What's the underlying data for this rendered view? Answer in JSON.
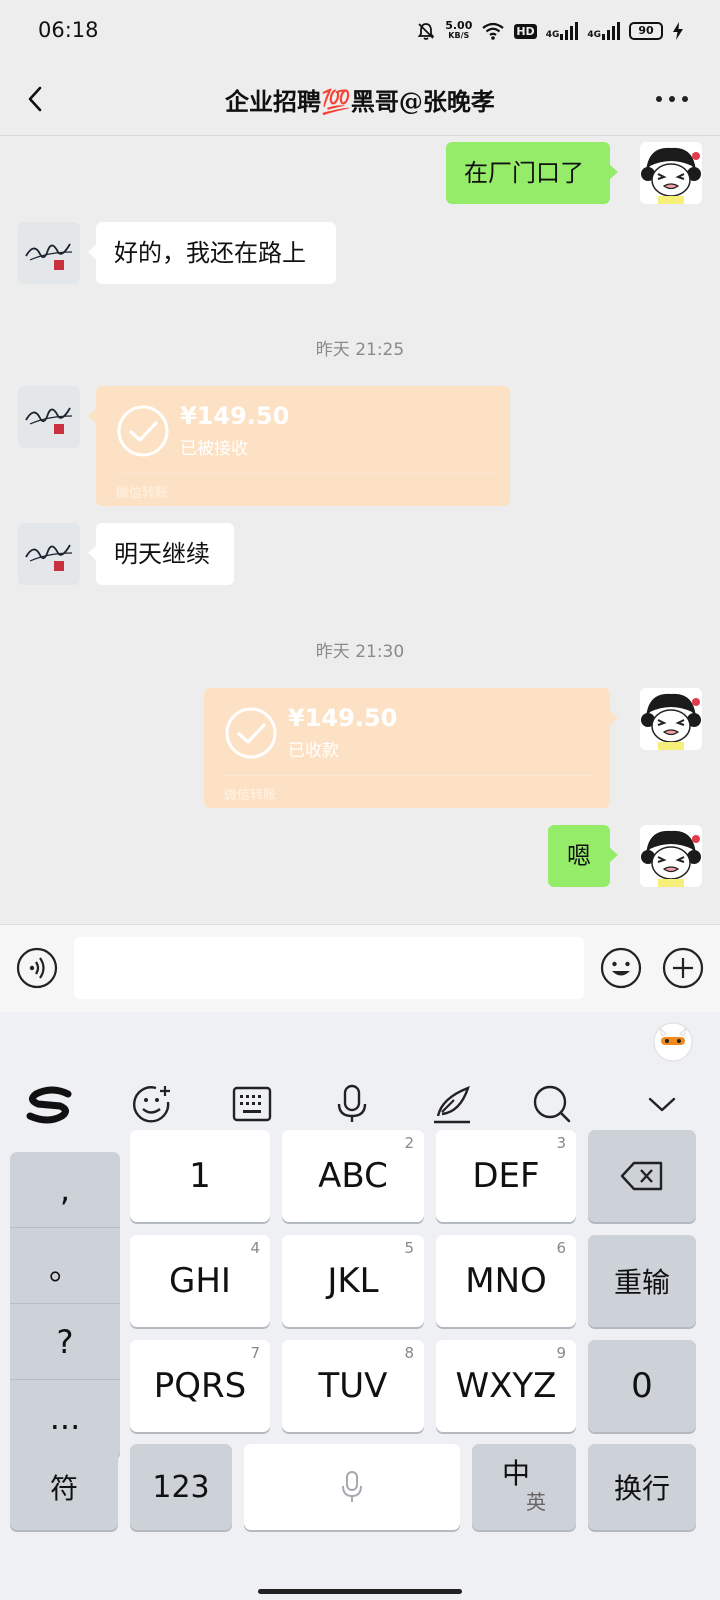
{
  "status": {
    "time": "06:18",
    "speed_value": "5.00",
    "speed_unit": "KB/S",
    "hd": "HD",
    "net1": "4G",
    "net2": "4G",
    "battery": "90"
  },
  "header": {
    "title": "企业招聘💯黑哥@张晚孝"
  },
  "messages": {
    "m1": "在厂门口了",
    "m2": "好的，我还在路上",
    "ts1": "昨天 21:25",
    "t1_amount": "¥149.50",
    "t1_status": "已被接收",
    "t1_footer": "微信转账",
    "m3": "明天继续",
    "ts2": "昨天 21:30",
    "t2_amount": "¥149.50",
    "t2_status": "已收款",
    "t2_footer": "微信转账",
    "m4": "嗯"
  },
  "input": {
    "value": "",
    "placeholder": ""
  },
  "keyboard": {
    "punct": [
      ",",
      "。",
      "?",
      "..."
    ],
    "keys": {
      "k1": "1",
      "k2": "ABC",
      "k2_sub": "2",
      "k3": "DEF",
      "k3_sub": "3",
      "k4": "GHI",
      "k4_sub": "4",
      "k5": "JKL",
      "k5_sub": "5",
      "k6": "MNO",
      "k6_sub": "6",
      "k7": "PQRS",
      "k7_sub": "7",
      "k8": "TUV",
      "k8_sub": "8",
      "k9": "WXYZ",
      "k9_sub": "9",
      "k0": "0",
      "retype": "重输",
      "symbol": "符",
      "num": "123",
      "lang_main": "中",
      "lang_alt": "英",
      "enter": "换行"
    }
  },
  "colors": {
    "bg": "#ededed",
    "green_bubble": "#95ec69",
    "transfer": "#fde1c4"
  }
}
